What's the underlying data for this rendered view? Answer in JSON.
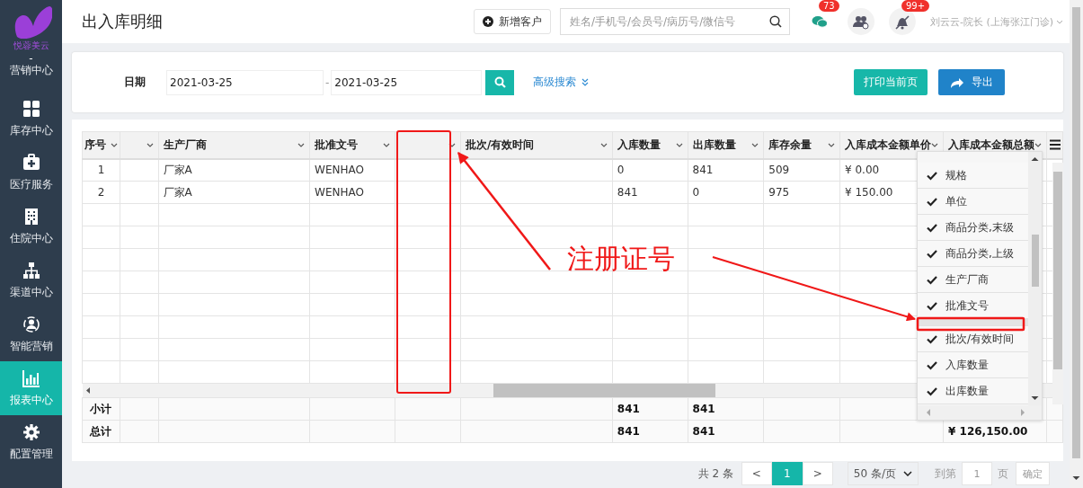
{
  "sidebar": {
    "brand": "悦蓉美云",
    "separator": "-",
    "items": [
      {
        "label": "营销中心",
        "selected": false
      },
      {
        "label": "库存中心",
        "selected": false
      },
      {
        "label": "医疗服务",
        "selected": false
      },
      {
        "label": "住院中心",
        "selected": false
      },
      {
        "label": "渠道中心",
        "selected": false
      },
      {
        "label": "智能营销",
        "selected": false
      },
      {
        "label": "报表中心",
        "selected": true
      },
      {
        "label": "配置管理",
        "selected": false
      }
    ]
  },
  "header": {
    "title": "出入库明细",
    "new_button": "新增客户",
    "search": {
      "placeholder": "姓名/手机号/会员号/病历号/微信号"
    },
    "chat_badge": "73",
    "notice_badge": "99+",
    "user": "刘云云-院长 (上海张江门诊)"
  },
  "filter": {
    "date_label": "日期",
    "date_from": "2021-03-25",
    "date_sep": "-",
    "date_to": "2021-03-25",
    "advanced": "高级搜索",
    "print_button": "打印当前页",
    "export_button": "导出"
  },
  "table": {
    "columns": {
      "no": "序号",
      "manufacturer": "生产厂商",
      "approval_no": "批准文号",
      "batch": "批次/有效时间",
      "in_qty": "入库数量",
      "out_qty": "出库数量",
      "stock": "库存余量",
      "unit_cost": "入库成本金额单价",
      "total_cost": "入库成本金额总额"
    },
    "rows": [
      {
        "no": "1",
        "manufacturer": "厂家A",
        "approval_no": "WENHAO",
        "in_qty": "0",
        "out_qty": "841",
        "stock": "509",
        "unit_cost": "¥ 0.00"
      },
      {
        "no": "2",
        "manufacturer": "厂家A",
        "approval_no": "WENHAO",
        "in_qty": "841",
        "out_qty": "0",
        "stock": "975",
        "unit_cost": "¥ 150.00"
      }
    ],
    "footer": [
      {
        "no": "小计",
        "in_qty": "841",
        "out_qty": "841"
      },
      {
        "no": "总计",
        "in_qty": "841",
        "out_qty": "841",
        "total_cost": "¥ 126,150.00"
      }
    ]
  },
  "column_menu": {
    "items": [
      {
        "kind": "item",
        "label": "规格",
        "checked": true
      },
      {
        "kind": "item",
        "label": "单位",
        "checked": true
      },
      {
        "kind": "item",
        "label": "商品分类,末级",
        "checked": true
      },
      {
        "kind": "item",
        "label": "商品分类,上级",
        "checked": true
      },
      {
        "kind": "item",
        "label": "生产厂商",
        "checked": true
      },
      {
        "kind": "item",
        "label": "批准文号",
        "checked": true
      },
      {
        "kind": "blank"
      },
      {
        "kind": "item",
        "label": "批次/有效时间",
        "checked": true
      },
      {
        "kind": "item",
        "label": "入库数量",
        "checked": true
      },
      {
        "kind": "item",
        "label": "出库数量",
        "checked": true
      }
    ]
  },
  "pager": {
    "total": "共 2 条",
    "prev": "<",
    "pages": [
      {
        "label": "1",
        "selected": true
      }
    ],
    "next": ">",
    "page_size": "50 条/页",
    "goto_label": "到第",
    "goto_value": "1",
    "page_unit": "页",
    "confirm": "确定"
  },
  "annotation": {
    "label": "注册证号"
  }
}
